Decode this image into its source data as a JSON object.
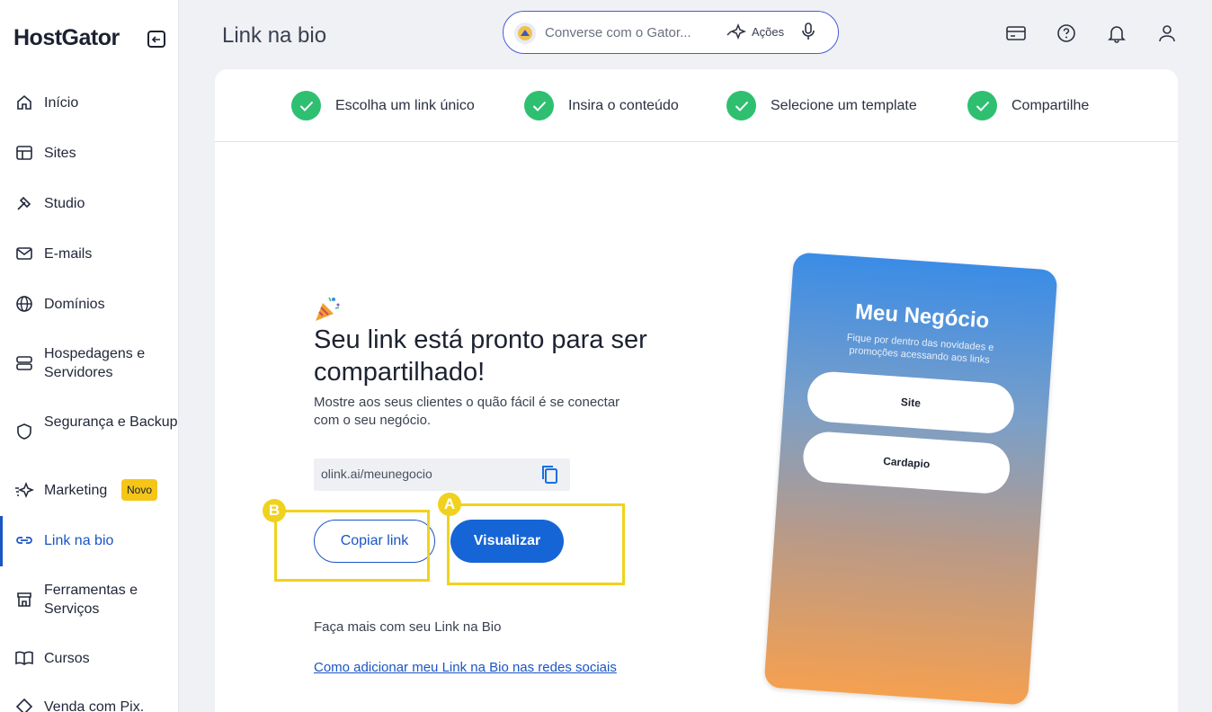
{
  "sidebar": {
    "brand": "HostGator",
    "items": [
      {
        "label": "Início",
        "icon": "home-icon"
      },
      {
        "label": "Sites",
        "icon": "layout-icon"
      },
      {
        "label": "Studio",
        "icon": "tools-icon"
      },
      {
        "label": "E-mails",
        "icon": "mail-icon"
      },
      {
        "label": "Domínios",
        "icon": "globe-icon"
      },
      {
        "label": "Hospedagens e Servidores",
        "icon": "server-icon"
      },
      {
        "label": "Segurança e Backup",
        "icon": "shield-icon"
      },
      {
        "label": "Marketing",
        "icon": "sparkle-icon",
        "badge": "Novo"
      },
      {
        "label": "Link na bio",
        "icon": "link-icon",
        "active": true
      },
      {
        "label": "Ferramentas e Serviços",
        "icon": "store-icon"
      },
      {
        "label": "Cursos",
        "icon": "book-icon"
      },
      {
        "label": "Venda com Pix.",
        "icon": "pix-icon"
      }
    ]
  },
  "header": {
    "title": "Link na bio",
    "search_placeholder": "Converse com o Gator...",
    "actions_label": "Ações",
    "icons": [
      "card-icon",
      "help-icon",
      "bell-icon",
      "user-icon"
    ]
  },
  "steps": [
    {
      "label": "Escolha um link único",
      "done": true
    },
    {
      "label": "Insira o conteúdo",
      "done": true
    },
    {
      "label": "Selecione um template",
      "done": true
    },
    {
      "label": "Compartilhe",
      "done": true
    }
  ],
  "main": {
    "headline": "Seu link está pronto para ser compartilhado!",
    "subtext": "Mostre aos seus clientes o quão fácil é se conectar com o seu negócio.",
    "link_value": "olink.ai/meunegocio",
    "copy_button": "Copiar link",
    "view_button": "Visualizar",
    "more_text": "Faça mais com seu Link na Bio",
    "more_link": "Como adicionar meu Link na Bio nas redes sociais"
  },
  "markers": {
    "a": "A",
    "b": "B"
  },
  "phone": {
    "title": "Meu Negócio",
    "subtitle": "Fique por dentro das novidades e promoções acessando aos links",
    "buttons": [
      "Site",
      "Cardapio"
    ]
  },
  "colors": {
    "accent": "#1565d6",
    "success": "#2fbf71",
    "highlight": "#f0d21e",
    "badge": "#f5c518"
  }
}
